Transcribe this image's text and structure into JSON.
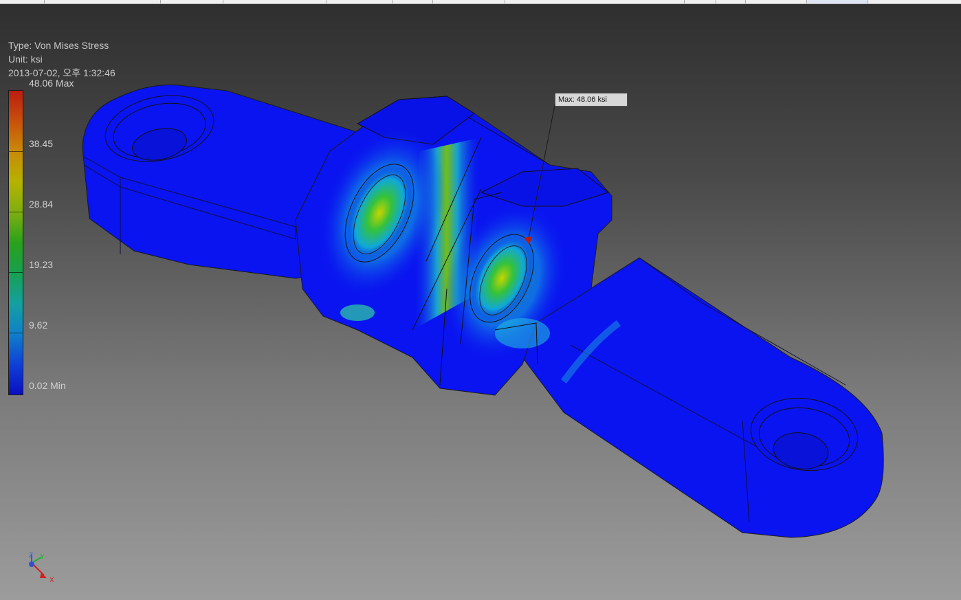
{
  "legend": {
    "type_line": "Type: Von Mises Stress",
    "unit_line": "Unit: ksi",
    "date_line": "2013-07-02, 오후 1:32:46",
    "labels": [
      "48.06 Max",
      "38.45",
      "28.84",
      "19.23",
      "9.62",
      "0.02 Min"
    ]
  },
  "callout": {
    "text": "Max: 48.06 ksi"
  },
  "triad": {
    "z": "Z",
    "y": "Y",
    "x": "X"
  },
  "colors": {
    "stress_low": "#0a14f0",
    "stress_mid": "#18a050",
    "stress_high": "#b81d10"
  },
  "icons": {
    "triad": "view-axis-triad-icon"
  }
}
